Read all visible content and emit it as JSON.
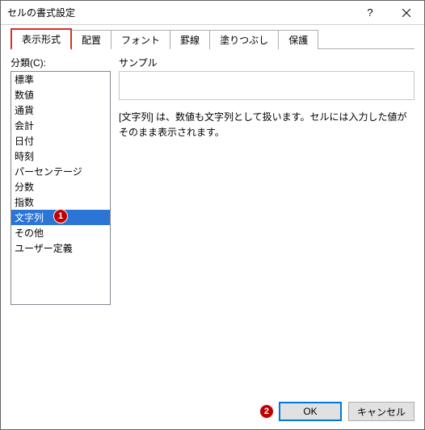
{
  "titlebar": {
    "title": "セルの書式設定"
  },
  "tabs": [
    {
      "label": "表示形式"
    },
    {
      "label": "配置"
    },
    {
      "label": "フォント"
    },
    {
      "label": "罫線"
    },
    {
      "label": "塗りつぶし"
    },
    {
      "label": "保護"
    }
  ],
  "active_tab_index": 0,
  "category": {
    "label": "分類(C):",
    "items": [
      "標準",
      "数値",
      "通貨",
      "会計",
      "日付",
      "時刻",
      "パーセンテージ",
      "分数",
      "指数",
      "文字列",
      "その他",
      "ユーザー定義"
    ],
    "selected_index": 9
  },
  "sample": {
    "label": "サンプル",
    "value": ""
  },
  "description": "[文字列] は、数値も文字列として扱います。セルには入力した値がそのまま表示されます。",
  "buttons": {
    "ok": "OK",
    "cancel": "キャンセル"
  },
  "callouts": {
    "one": "1",
    "two": "2"
  }
}
